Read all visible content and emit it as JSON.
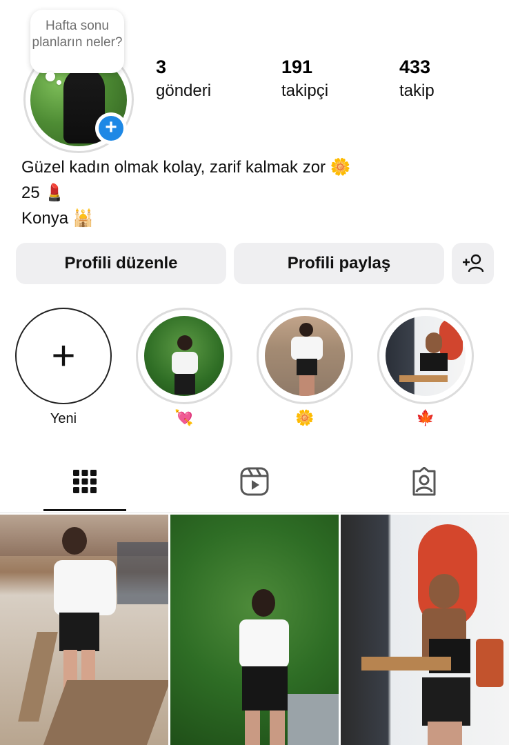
{
  "profile": {
    "note": "Hafta sonu planların neler?",
    "stats": [
      {
        "value": "3",
        "label": "gönderi"
      },
      {
        "value": "191",
        "label": "takipçi"
      },
      {
        "value": "433",
        "label": "takip"
      }
    ],
    "bio": {
      "line1": "Güzel kadın olmak kolay, zarif kalmak zor",
      "line1_emoji": "🌼",
      "line2": "25",
      "line2_emoji": "💄",
      "line3": "Konya",
      "line3_emoji": "🕌"
    }
  },
  "buttons": {
    "edit": "Profili düzenle",
    "share": "Profili paylaş"
  },
  "highlights": [
    {
      "label": "Yeni"
    },
    {
      "label": "💘"
    },
    {
      "label": "🌼"
    },
    {
      "label": "🍁"
    }
  ],
  "icons": {
    "add_badge": "plus-icon",
    "add_person": "add-person-icon",
    "grid_tab": "grid-icon",
    "reels_tab": "reels-icon",
    "tagged_tab": "tagged-icon"
  },
  "colors": {
    "accent": "#1e88e5",
    "button_bg": "#efeff1"
  }
}
